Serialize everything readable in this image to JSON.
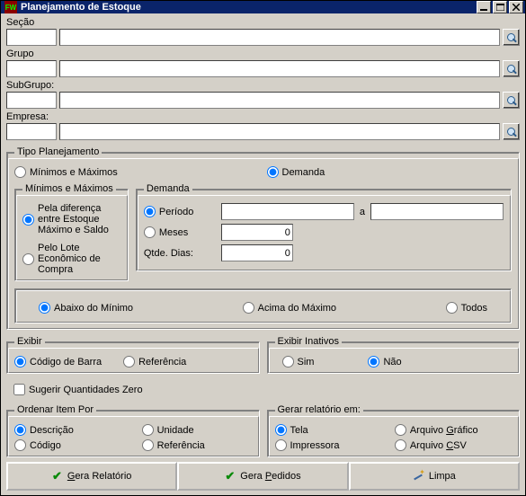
{
  "titlebar": {
    "icon_text": "FW",
    "title": "Planejamento de Estoque"
  },
  "lookup": {
    "secao_label": "Seção",
    "grupo_label": "Grupo",
    "subgrupo_label": "SubGrupo:",
    "empresa_label": "Empresa:",
    "secao_code": "",
    "secao_desc": "",
    "grupo_code": "",
    "grupo_desc": "",
    "subgrupo_code": "",
    "subgrupo_desc": "",
    "empresa_code": "",
    "empresa_desc": ""
  },
  "tipo_planejamento": {
    "legend": "Tipo Planejamento",
    "minmax_label": "Mínimos e Máximos",
    "demanda_label": "Demanda",
    "selected": "demanda",
    "minmax_box": {
      "legend": "Mínimos e Máximos",
      "pela_diferenca": "Pela diferença entre Estoque Máximo e Saldo",
      "pelo_lote": "Pelo Lote Econômico de Compra",
      "selected": "pela_diferenca"
    },
    "demanda_box": {
      "legend": "Demanda",
      "periodo_label": "Período",
      "a_label": "a",
      "meses_label": "Meses",
      "qtde_dias_label": "Qtde. Dias:",
      "periodo_de": "",
      "periodo_ate": "",
      "meses_value": "0",
      "qtde_dias_value": "0",
      "selected": "periodo"
    },
    "filtro_nivel": {
      "abaixo": "Abaixo do Mínimo",
      "acima": "Acima do Máximo",
      "todos": "Todos",
      "selected": "abaixo"
    }
  },
  "exibir": {
    "legend": "Exibir",
    "codigo_barra": "Código de Barra",
    "referencia": "Referência",
    "selected": "codigo_barra"
  },
  "exibir_inativos": {
    "legend": "Exibir Inativos",
    "sim": "Sim",
    "nao": "Não",
    "selected": "nao"
  },
  "sugerir_zero": {
    "label": "Sugerir Quantidades Zero",
    "checked": false
  },
  "ordenar": {
    "legend": "Ordenar Item Por",
    "descricao": "Descrição",
    "unidade": "Unidade",
    "codigo": "Código",
    "referencia": "Referência",
    "selected": "descricao"
  },
  "gerar_rel": {
    "legend": "Gerar relatório em:",
    "tela": "Tela",
    "grafico_pre": "Arquivo ",
    "grafico_u": "G",
    "grafico_post": "ráfico",
    "impressora": "Impressora",
    "csv_pre": "Arquivo ",
    "csv_u": "C",
    "csv_post": "SV",
    "selected": "tela"
  },
  "buttons": {
    "gera_relatorio_pre": "",
    "gera_relatorio_u": "G",
    "gera_relatorio_post": "era Relatório",
    "gera_pedidos_pre": "Gera ",
    "gera_pedidos_u": "P",
    "gera_pedidos_post": "edidos",
    "limpa": "Limpa"
  }
}
